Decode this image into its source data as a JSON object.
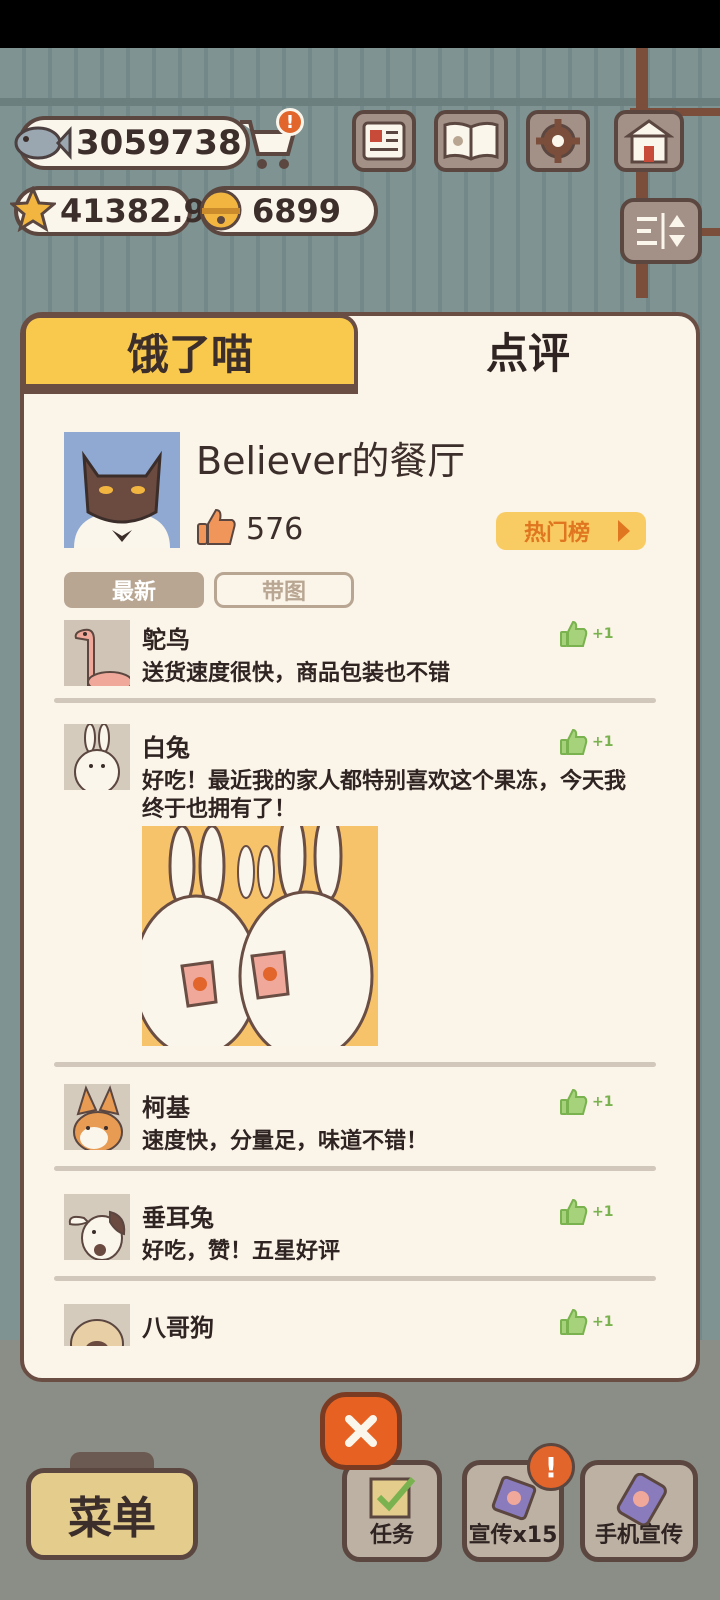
{
  "hud": {
    "fish_count": "3059738",
    "star_count": "41382.9",
    "bell_count": "6899",
    "cart_badge": "!"
  },
  "panel": {
    "tab_hungry_cat": "饿了喵",
    "tab_review": "点评",
    "restaurant_name": "Believer的餐厅",
    "like_count": "576",
    "hot_rank_label": "热门榜",
    "filter_latest": "最新",
    "filter_with_image": "带图"
  },
  "reviews": [
    {
      "name": "鸵鸟",
      "text": "送货速度很快，商品包装也不错",
      "like": "+1"
    },
    {
      "name": "白兔",
      "text": "好吃！最近我的家人都特别喜欢这个果冻，今天我终于也拥有了！",
      "like": "+1"
    },
    {
      "name": "柯基",
      "text": "速度快，分量足，味道不错！",
      "like": "+1"
    },
    {
      "name": "垂耳兔",
      "text": "好吃，赞！五星好评",
      "like": "+1"
    },
    {
      "name": "八哥狗",
      "text": "",
      "like": "+1"
    }
  ],
  "bottom": {
    "menu_label": "菜单",
    "task_label": "任务",
    "promote_label": "宣传x15",
    "promote_badge": "!",
    "phone_promote_label": "手机宣传"
  },
  "colors": {
    "accent_tab": "#f8c94c",
    "panel_bg": "#fbf4e8",
    "border": "#6a4e44",
    "like_green": "#79b24f",
    "hot_orange": "#e0761f",
    "close_red": "#e76222"
  }
}
